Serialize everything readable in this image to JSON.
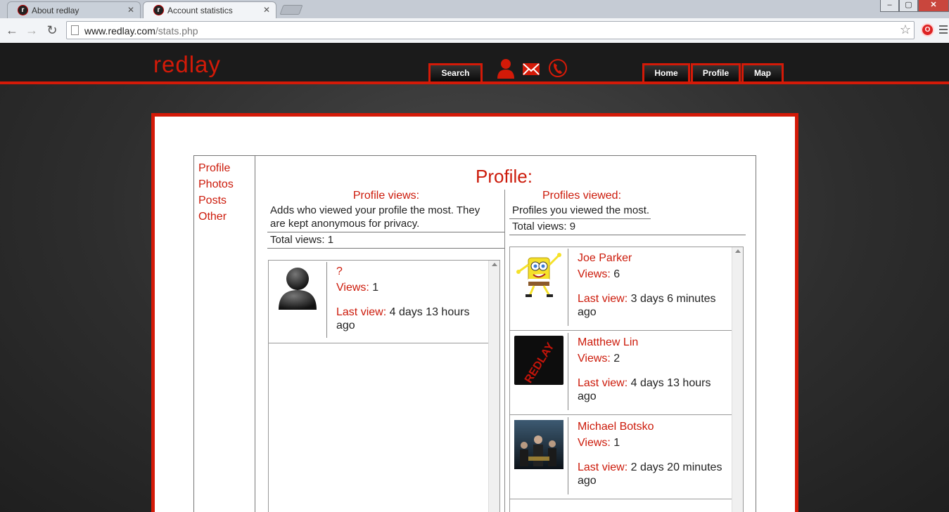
{
  "browser": {
    "tabs": [
      {
        "title": "About redlay",
        "favicon": "r"
      },
      {
        "title": "Account statistics",
        "favicon": "r"
      }
    ],
    "url_host": "www.redlay.com",
    "url_path": "/stats.php",
    "extension_label": "O"
  },
  "site": {
    "logo": "redlay",
    "nav": {
      "search": "Search",
      "home": "Home",
      "profile": "Profile",
      "map": "Map"
    },
    "icons": [
      "user-icon",
      "mail-icon",
      "phone-icon"
    ],
    "accent": "#d41a08"
  },
  "sidebar": {
    "items": [
      "Profile",
      "Photos",
      "Posts",
      "Other"
    ]
  },
  "main": {
    "title": "Profile:",
    "profile_views": {
      "title": "Profile views:",
      "description": "Adds who viewed your profile the most. They are kept anonymous for privacy.",
      "total": "Total views: 1",
      "entries": [
        {
          "name": "?",
          "views_label": "Views:",
          "views": "1",
          "last_label": "Last view:",
          "last": "4 days 13 hours ago",
          "thumb": "anonymous-avatar"
        }
      ]
    },
    "profiles_viewed": {
      "title": "Profiles viewed:",
      "description": "Profiles you viewed the most.",
      "total": "Total views: 9",
      "entries": [
        {
          "name": "Joe Parker",
          "views_label": "Views:",
          "views": "6",
          "last_label": "Last view:",
          "last": "3 days 6 minutes ago",
          "thumb": "spongebob-avatar"
        },
        {
          "name": "Matthew Lin",
          "views_label": "Views:",
          "views": "2",
          "last_label": "Last view:",
          "last": "4 days 13 hours ago",
          "thumb": "redlay-logo-avatar",
          "thumb_text": "REDLAY"
        },
        {
          "name": "Michael Botsko",
          "views_label": "Views:",
          "views": "1",
          "last_label": "Last view:",
          "last": "2 days 20 minutes ago",
          "thumb": "movie-poster-avatar"
        }
      ]
    }
  }
}
